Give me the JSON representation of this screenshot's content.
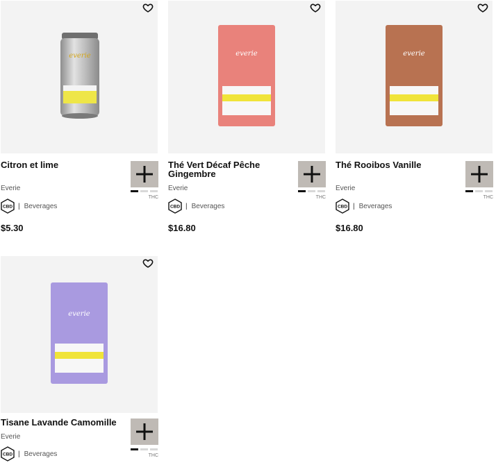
{
  "products": [
    {
      "name": "Citron et lime",
      "brand": "Everie",
      "category": "Beverages",
      "cannabinoid_badge": "CBD",
      "price": "$5.30",
      "potency_label": "THC",
      "potency_level": 1,
      "image": {
        "kind": "can",
        "logo": "everie",
        "color": "#b8b8b8"
      }
    },
    {
      "name": "Thé Vert Décaf Pêche Gingembre",
      "brand": "Everie",
      "category": "Beverages",
      "cannabinoid_badge": "CBD",
      "price": "$16.80",
      "potency_label": "THC",
      "potency_level": 1,
      "image": {
        "kind": "pouch",
        "logo": "everie",
        "color": "#e9827b"
      }
    },
    {
      "name": "Thé Rooibos Vanille",
      "brand": "Everie",
      "category": "Beverages",
      "cannabinoid_badge": "CBD",
      "price": "$16.80",
      "potency_label": "THC",
      "potency_level": 1,
      "image": {
        "kind": "pouch",
        "logo": "everie",
        "color": "#b87251"
      }
    },
    {
      "name": "Tisane Lavande Camomille",
      "brand": "Everie",
      "category": "Beverages",
      "cannabinoid_badge": "CBD",
      "price": "",
      "potency_label": "THC",
      "potency_level": 1,
      "image": {
        "kind": "pouch",
        "logo": "everie",
        "color": "#a99ae0"
      }
    }
  ],
  "icons": {
    "favorite": "heart-outline-icon",
    "add": "plus-icon",
    "badge": "cbd-hexagon-icon"
  },
  "separator": "|"
}
